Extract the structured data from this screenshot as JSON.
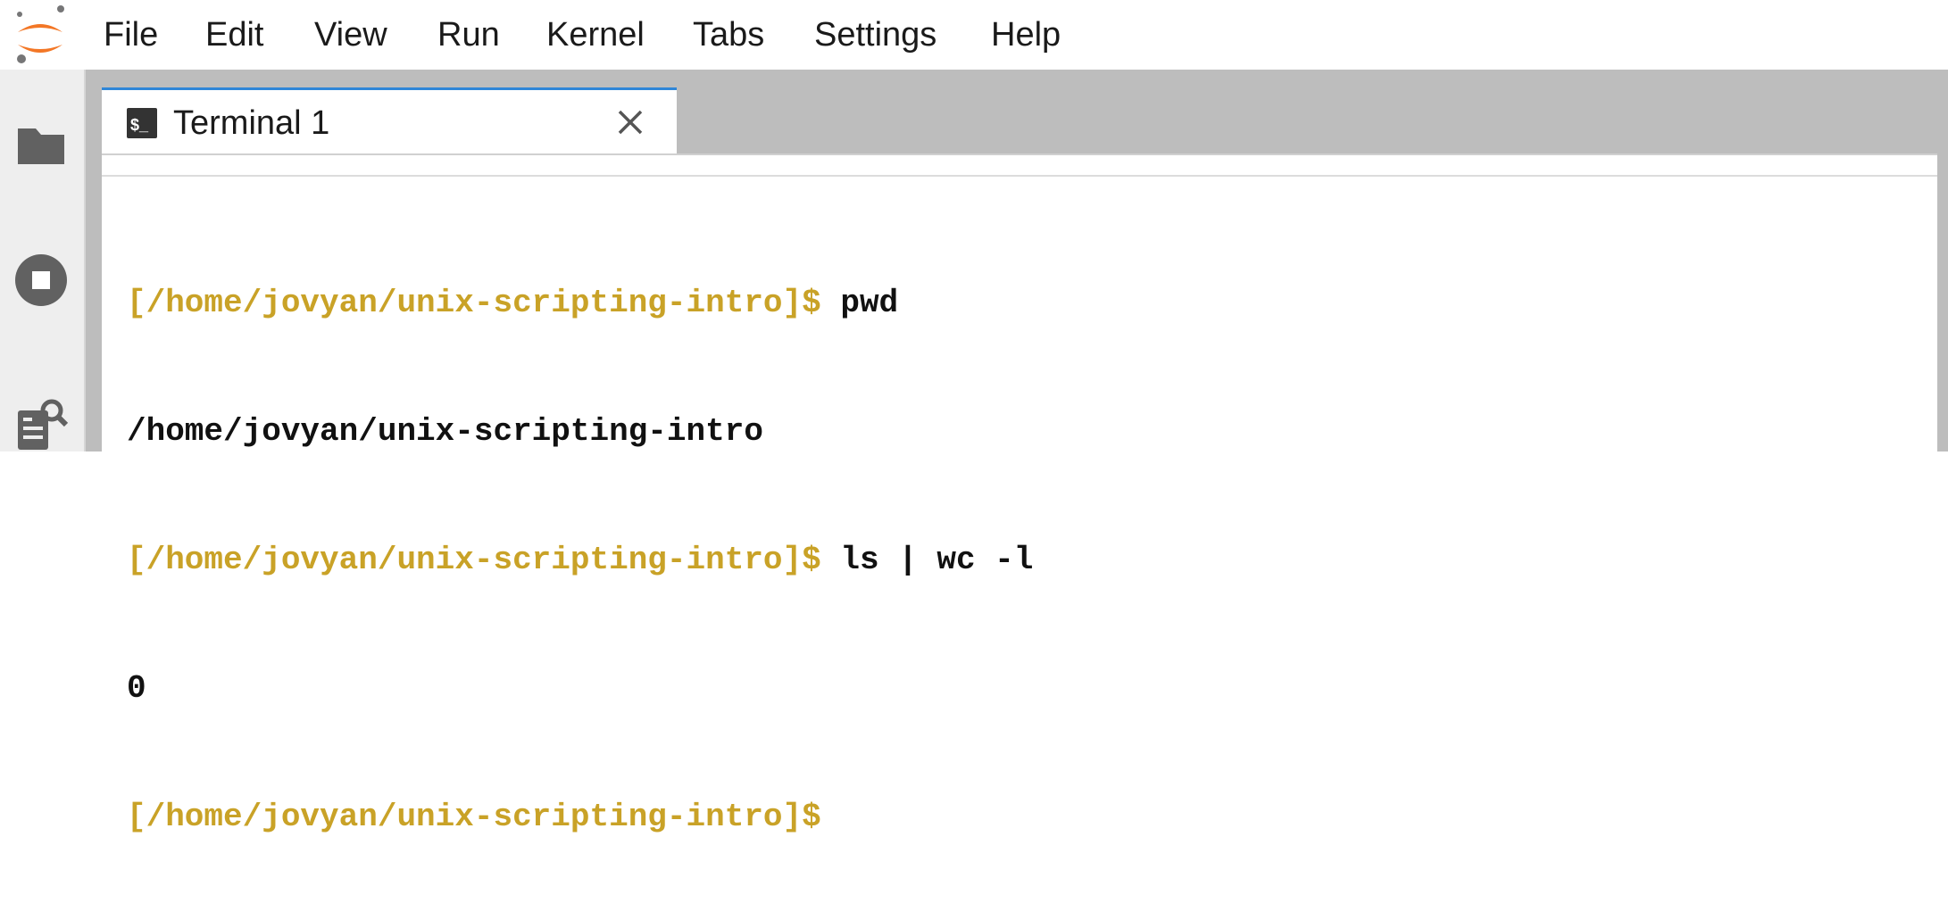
{
  "menu": [
    "File",
    "Edit",
    "View",
    "Run",
    "Kernel",
    "Tabs",
    "Settings",
    "Help"
  ],
  "sidebar": {
    "icons": [
      "folder-icon",
      "stop-circle-icon",
      "property-inspector-icon"
    ]
  },
  "tab": {
    "icon": "terminal-icon",
    "icon_text": "$_",
    "label": "Terminal 1",
    "close": "close-icon"
  },
  "terminal": {
    "lines": [
      {
        "prompt": "[/home/jovyan/unix-scripting-intro]$",
        "command": " pwd",
        "output": ""
      },
      {
        "prompt": "",
        "command": "",
        "output": "/home/jovyan/unix-scripting-intro"
      },
      {
        "prompt": "[/home/jovyan/unix-scripting-intro]$",
        "command": " ls | wc -l",
        "output": ""
      },
      {
        "prompt": "",
        "command": "",
        "output": "0"
      },
      {
        "prompt": "[/home/jovyan/unix-scripting-intro]$",
        "command": "",
        "output": ""
      }
    ]
  },
  "colors": {
    "prompt": "#c9a227",
    "tab_accent": "#2f86d8",
    "dock_background": "#bdbdbd",
    "logo_orange": "#f37726"
  }
}
